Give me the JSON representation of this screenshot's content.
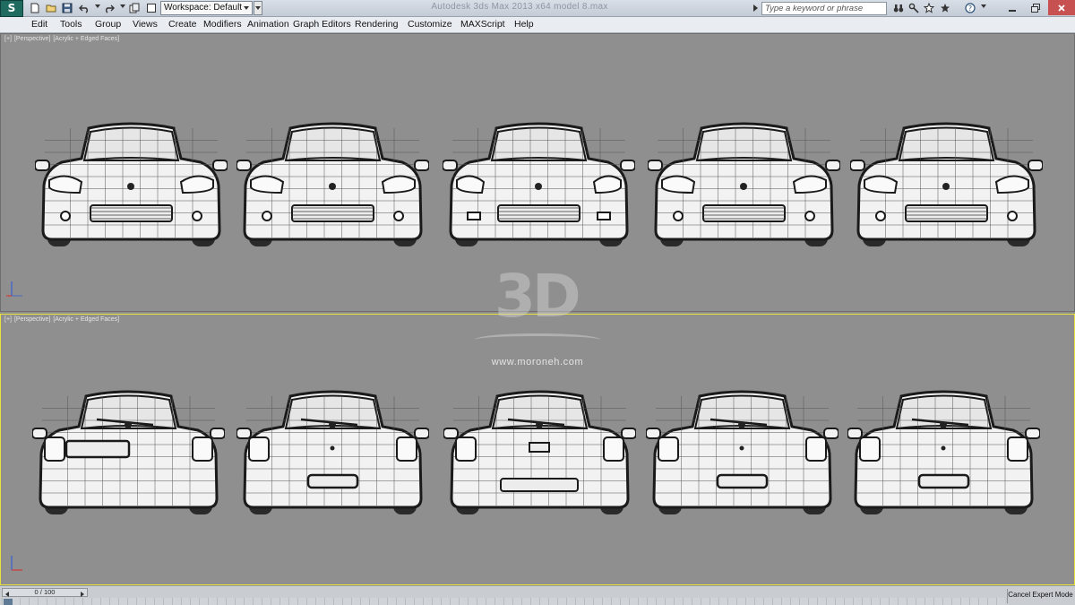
{
  "titlebar": {
    "app_icon": "3ds-max-logo",
    "app_icon_glyph": "S",
    "quick_access": [
      "new-icon",
      "open-icon",
      "save-icon",
      "undo-icon",
      "redo-icon",
      "project-folder-icon",
      "hold-icon"
    ],
    "workspace_label": "Workspace: Default",
    "window_title": "Autodesk 3ds Max  2013 x64     model 8.max",
    "search_placeholder": "Type a keyword or phrase",
    "tools": [
      "binoculars-icon",
      "key-tools-icon",
      "star-icon",
      "favorites-icon",
      "help-icon"
    ],
    "window_controls": [
      "minimize-icon",
      "restore-icon",
      "close-icon"
    ]
  },
  "menu": {
    "items": [
      "Edit",
      "Tools",
      "Group",
      "Views",
      "Create",
      "Modifiers",
      "Animation",
      "Graph Editors",
      "Rendering",
      "Customize",
      "MAXScript",
      "Help"
    ]
  },
  "viewports": {
    "top_label": [
      "[+]",
      "[Perspective]",
      "[Acrylic + Edged Faces]"
    ],
    "bottom_label": [
      "[+]",
      "[Perspective]",
      "[Acrylic + Edged Faces]"
    ],
    "active_border": "#e8e23a",
    "background": "#8f8f8f"
  },
  "cars_front": [
    "front-variant-1",
    "front-variant-2",
    "front-variant-3",
    "front-variant-4",
    "front-variant-5"
  ],
  "cars_rear": [
    "rear-variant-1",
    "rear-variant-2",
    "rear-variant-3",
    "rear-variant-4",
    "rear-variant-5"
  ],
  "watermark": {
    "logo_text": "3D",
    "url": "www.moroneh.com"
  },
  "timeline": {
    "frame_counter": "0 / 100",
    "cancel_expert_mode": "Cancel Expert Mode"
  }
}
